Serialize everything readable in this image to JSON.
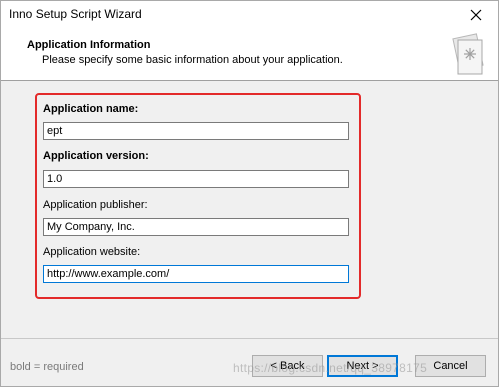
{
  "window": {
    "title": "Inno Setup Script Wizard",
    "close_glyph": "✕"
  },
  "header": {
    "title": "Application Information",
    "subtitle": "Please specify some basic information about your application."
  },
  "form": {
    "name_label": "Application name:",
    "name_value": "ept",
    "version_label": "Application version:",
    "version_value": "1.0",
    "publisher_label": "Application publisher:",
    "publisher_value": "My Company, Inc.",
    "website_label": "Application website:",
    "website_value": "http://www.example.com/"
  },
  "footer": {
    "note": "bold = required",
    "back_label": "< Back",
    "next_label": "Next >",
    "cancel_label": "Cancel",
    "watermark": "https://blog.csdn.net/qq_38978175"
  },
  "colors": {
    "highlight_border": "#e32a2a",
    "focus_border": "#0078d7"
  }
}
